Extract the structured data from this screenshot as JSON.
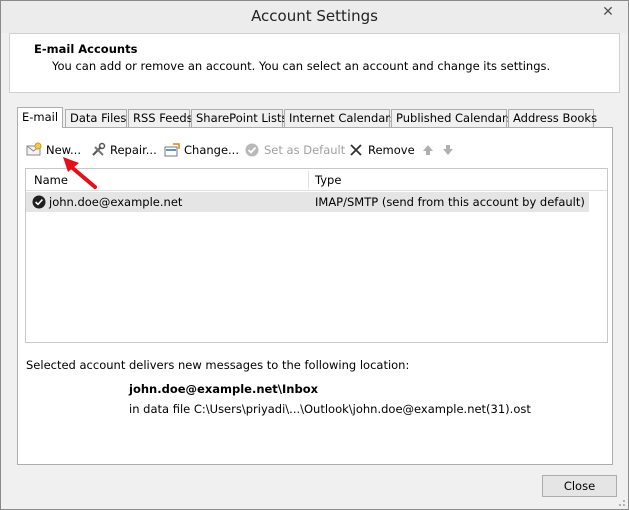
{
  "window": {
    "title": "Account Settings",
    "close_glyph": "✕"
  },
  "header": {
    "title": "E-mail Accounts",
    "description": "You can add or remove an account. You can select an account and change its settings."
  },
  "tabs": [
    {
      "label": "E-mail",
      "active": true
    },
    {
      "label": "Data Files"
    },
    {
      "label": "RSS Feeds"
    },
    {
      "label": "SharePoint Lists"
    },
    {
      "label": "Internet Calendars"
    },
    {
      "label": "Published Calendars"
    },
    {
      "label": "Address Books"
    }
  ],
  "toolbar": {
    "new_label": "New...",
    "repair_label": "Repair...",
    "change_label": "Change...",
    "set_default_label": "Set as Default",
    "remove_label": "Remove",
    "up_icon": "arrow-up-icon",
    "down_icon": "arrow-down-icon"
  },
  "accounts": {
    "columns": {
      "name": "Name",
      "type": "Type"
    },
    "rows": [
      {
        "name": "john.doe@example.net",
        "type": "IMAP/SMTP (send from this account by default)"
      }
    ]
  },
  "delivery": {
    "label": "Selected account delivers new messages to the following location:",
    "path": "john.doe@example.net\\Inbox",
    "file": "in data file C:\\Users\\priyadi\\...\\Outlook\\john.doe@example.net(31).ost"
  },
  "footer": {
    "close_label": "Close"
  },
  "colors": {
    "annotation_arrow": "#e3101c",
    "row_selected": "#e5e5e5"
  }
}
